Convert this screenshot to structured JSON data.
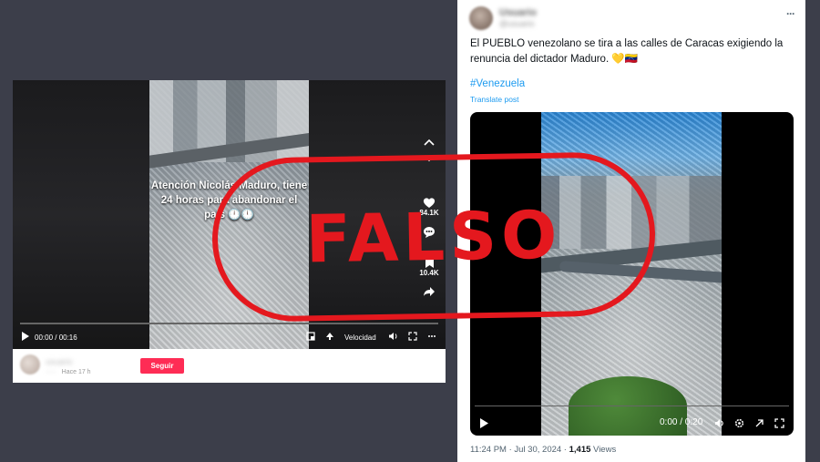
{
  "tiktok": {
    "caption": "Atención Nicolás Maduro, tiene 24 horas para abandonar el país",
    "caption_emoji": "🕛🕛",
    "likes": "84.1K",
    "saves": "10.4K",
    "time": "00:00 / 00:16",
    "speed_label": "Velocidad",
    "username": "usuario",
    "posted": "Hace 17 h",
    "follow_label": "Seguir"
  },
  "xpost": {
    "name": "Usuario",
    "handle": "@usuario",
    "text": "El PUEBLO venezolano se tira a las calles de Caracas exigiendo la renuncia del dictador Maduro. 💛🇻🇪",
    "hashtag": "#Venezuela",
    "translate_label": "Translate post",
    "video_time": "0:00 / 0:20",
    "timestamp": "11:24 PM · Jul 30, 2024 · ",
    "views_count": "1,415",
    "views_label": " Views"
  },
  "stamp": {
    "text": "FALSO",
    "color": "#e4181e"
  },
  "icons": [
    "chevron-up-icon",
    "chevron-down-icon",
    "heart-icon",
    "comment-icon",
    "bookmark-icon",
    "share-icon",
    "play-icon",
    "volume-icon",
    "fullscreen-icon",
    "settings-icon",
    "more-icon"
  ]
}
